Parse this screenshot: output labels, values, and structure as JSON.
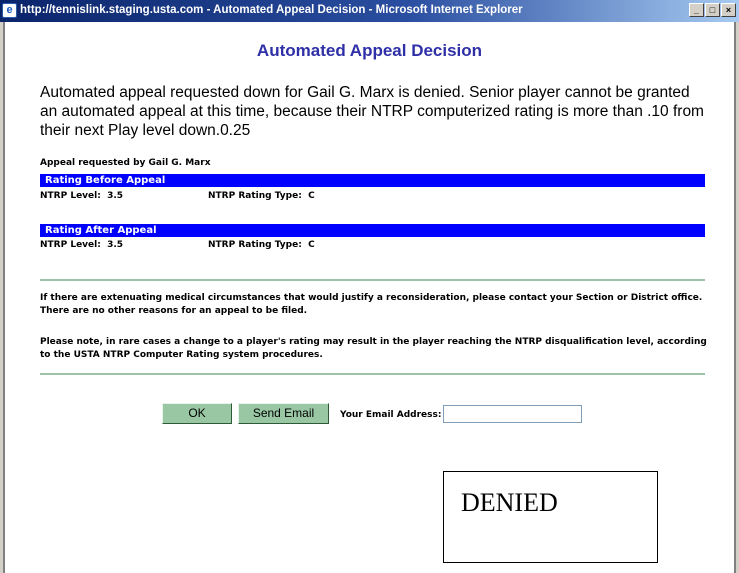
{
  "window": {
    "title": "http://tennislink.staging.usta.com - Automated Appeal Decision - Microsoft Internet Explorer",
    "buttons": {
      "minimize": "_",
      "maximize": "□",
      "close": "×"
    }
  },
  "page": {
    "title": "Automated Appeal Decision",
    "message": "Automated appeal requested down for Gail G. Marx is denied. Senior player cannot be granted an automated appeal at this time, because their NTRP computerized rating is more than .10 from their next Play level down.0.25",
    "requested_by": "Appeal requested by Gail G. Marx"
  },
  "before": {
    "header": "Rating Before Appeal",
    "level_label": "NTRP Level:",
    "level_value": "3.5",
    "type_label": "NTRP Rating Type:",
    "type_value": "C"
  },
  "after": {
    "header": "Rating After Appeal",
    "level_label": "NTRP Level:",
    "level_value": "3.5",
    "type_label": "NTRP Rating Type:",
    "type_value": "C"
  },
  "notes": {
    "medical": "If there are extenuating medical circumstances that would justify a reconsideration, please contact your Section or District office. There are no other reasons for an appeal to be filed.",
    "disqualification": "Please note, in rare cases a change to a player's rating may result in the player reaching the NTRP disqualification level, according to the USTA NTRP Computer Rating system procedures."
  },
  "actions": {
    "ok_label": "OK",
    "send_email_label": "Send Email",
    "email_label": "Your Email Address:",
    "email_value": ""
  },
  "stamp": {
    "text": "DENIED"
  },
  "colors": {
    "title": "#2f2fa8",
    "section_bar": "#0000ff",
    "button": "#99c7a4",
    "divider": "#9cc5a8"
  }
}
